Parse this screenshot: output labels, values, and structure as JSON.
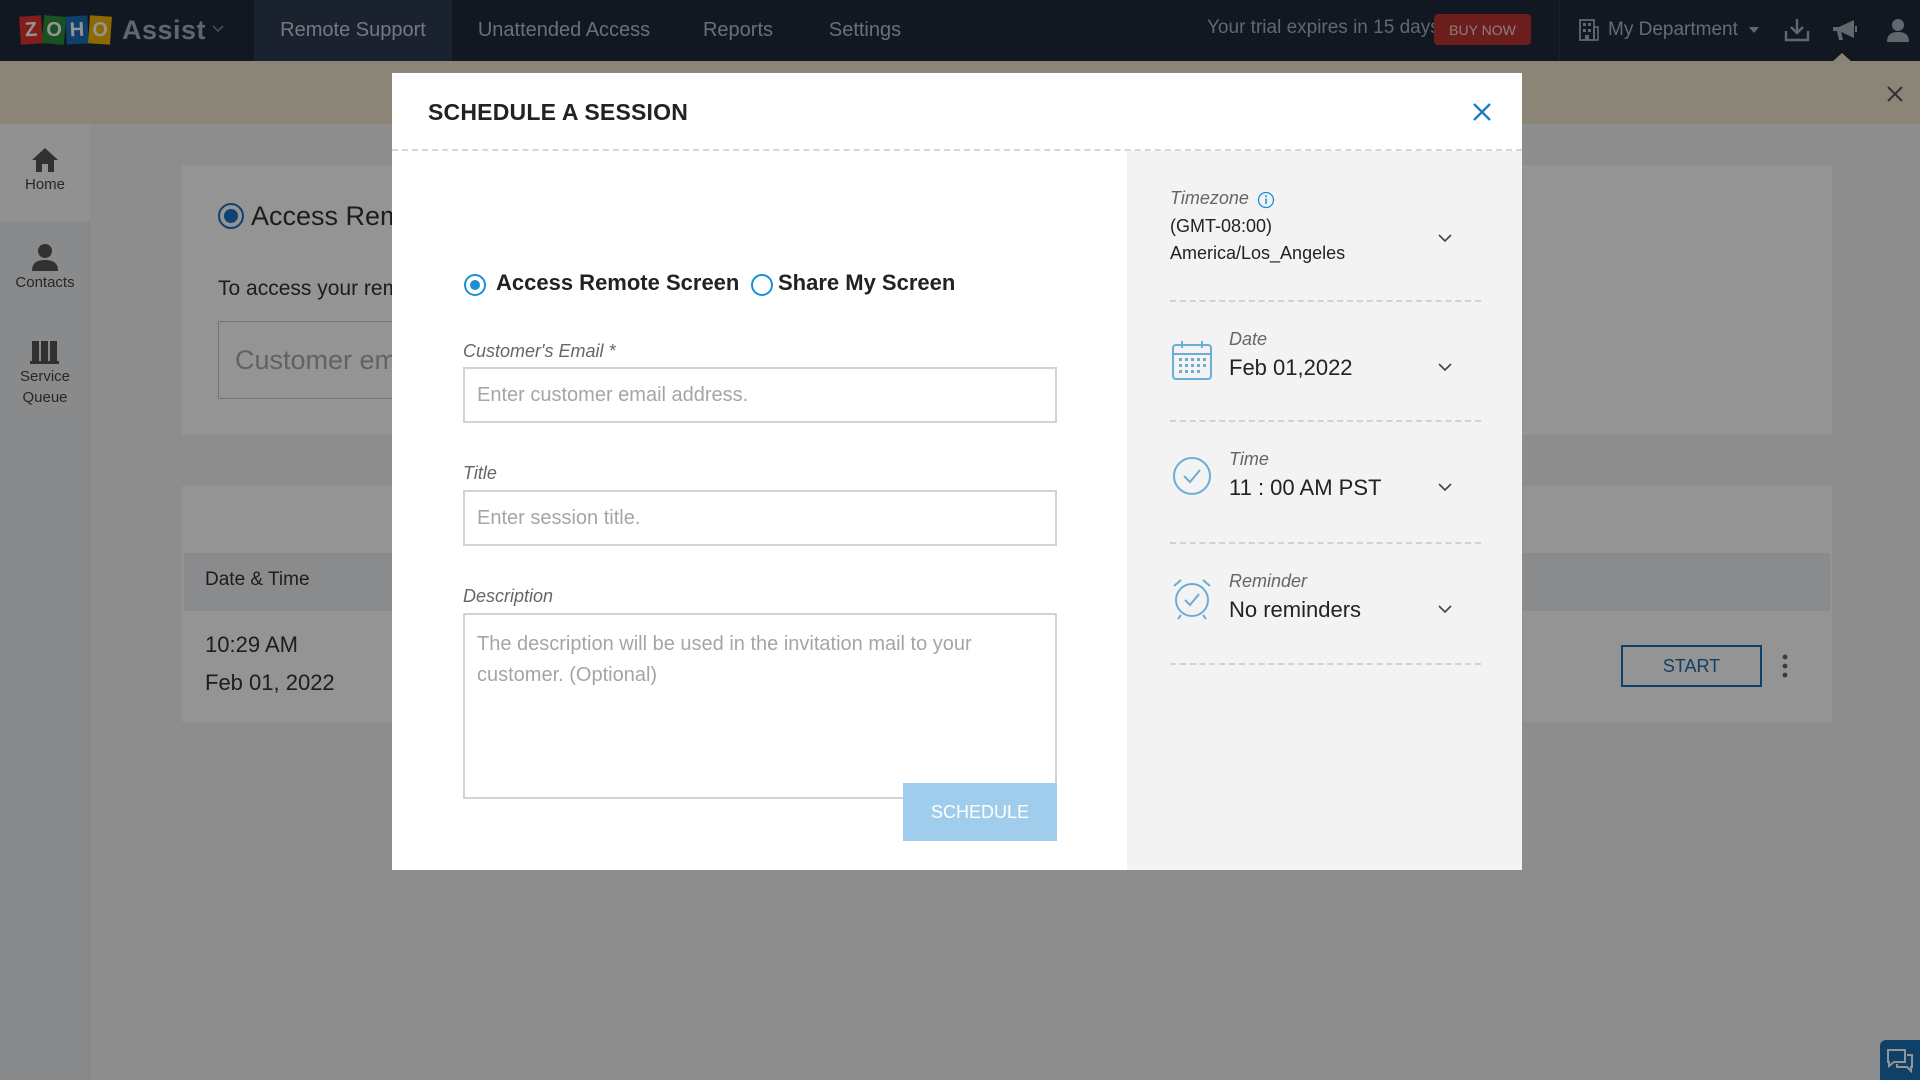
{
  "app": {
    "logo_letters": [
      "Z",
      "O",
      "H",
      "O"
    ],
    "logo_colors": [
      "#e0332c",
      "#2c8c3c",
      "#1c6fb7",
      "#f4b400"
    ],
    "product_name": "Assist"
  },
  "nav": {
    "tabs": [
      {
        "label": "Remote Support",
        "active": true
      },
      {
        "label": "Unattended Access",
        "active": false
      },
      {
        "label": "Reports",
        "active": false
      },
      {
        "label": "Settings",
        "active": false
      }
    ],
    "trial_text": "Your trial expires in 15 days.",
    "buy_now": "BUY NOW",
    "department": "My Department",
    "icons": [
      "download-icon",
      "announcement-icon",
      "user-icon"
    ]
  },
  "sidebar": {
    "items": [
      {
        "label": "Home",
        "icon": "home-icon",
        "active": true
      },
      {
        "label": "Contacts",
        "icon": "contacts-icon",
        "active": false
      },
      {
        "label": "Service Queue",
        "icon": "service-queue-icon",
        "active": false
      }
    ]
  },
  "background": {
    "radio_label": "Access Remote Screen",
    "instruction": "To access your remote",
    "email_placeholder": "Customer email",
    "table_header": "Date & Time",
    "row_time": "10:29 AM",
    "row_date": "Feb 01, 2022",
    "start_button": "START"
  },
  "modal": {
    "title": "SCHEDULE A SESSION",
    "mode_options": [
      {
        "label": "Access Remote Screen",
        "checked": true
      },
      {
        "label": "Share My Screen",
        "checked": false
      }
    ],
    "email_label": "Customer's Email *",
    "email_placeholder": "Enter customer email address.",
    "email_value": "",
    "title_label": "Title",
    "title_placeholder": "Enter session title.",
    "title_value": "",
    "description_label": "Description",
    "description_placeholder": "The description will be used in the invitation mail to your customer. (Optional)",
    "description_value": "",
    "schedule_button": "SCHEDULE",
    "timezone_label": "Timezone",
    "timezone_offset": "(GMT-08:00)",
    "timezone_name": "America/Los_Angeles",
    "date_label": "Date",
    "date_value": "Feb 01,2022",
    "time_label": "Time",
    "time_value": "11 : 00 AM PST",
    "reminder_label": "Reminder",
    "reminder_value": "No reminders"
  },
  "colors": {
    "nav_bg": "#1e2a3b",
    "accent": "#1b8fd6",
    "buy_now": "#b8352f",
    "schedule_button_disabled": "#9fcdeb",
    "banner": "#eee5cc"
  }
}
